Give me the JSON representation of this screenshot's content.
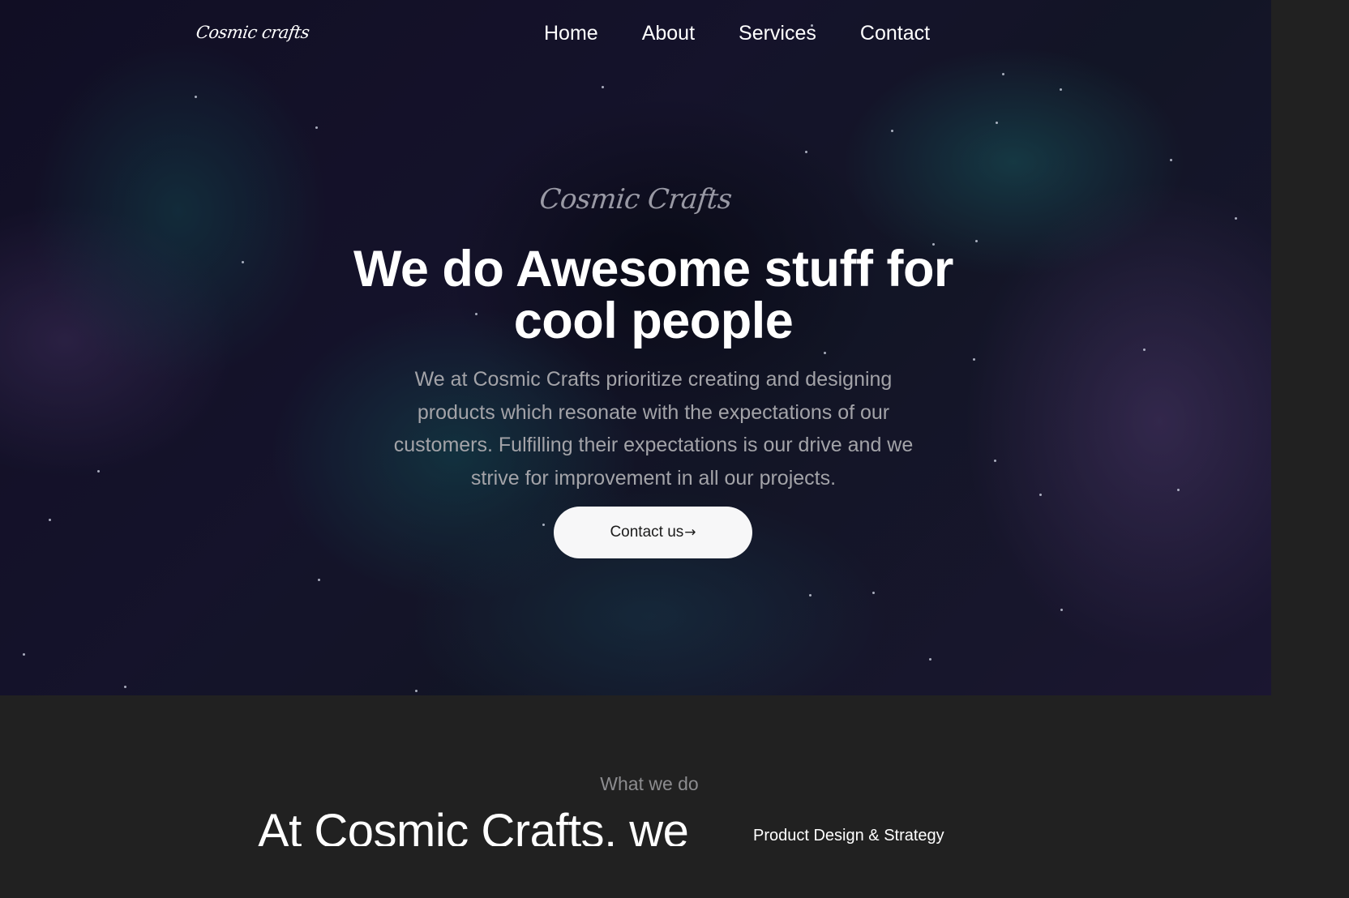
{
  "brand": {
    "logo": "Cosmic crafts"
  },
  "nav": {
    "items": [
      "Home",
      "About",
      "Services",
      "Contact"
    ]
  },
  "hero": {
    "eyebrow": "Cosmic Crafts",
    "headline": "We do Awesome stuff for cool people",
    "lead": "We at Cosmic Crafts prioritize creating and designing products which resonate with the expectations of our customers. Fulfilling their expectations is our drive and we strive for improvement in all our projects.",
    "cta_label": "Contact us",
    "cta_arrow": "→"
  },
  "what_we_do": {
    "eyebrow": "What we do",
    "heading": "At Cosmic Crafts, we",
    "service_1": "Product Design & Strategy"
  }
}
